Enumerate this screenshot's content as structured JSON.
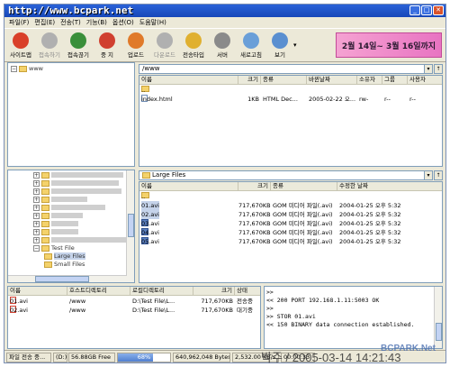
{
  "window": {
    "title": "http://www.bcpark.net"
  },
  "menu": [
    "파일(F)",
    "편집(E)",
    "전송(T)",
    "기능(B)",
    "옵션(O)",
    "도움말(H)"
  ],
  "toolbar": [
    {
      "label": "사이트맵",
      "icon": "sitemap-icon",
      "color": "#d9402a",
      "enabled": true
    },
    {
      "label": "접속하기",
      "icon": "connect-icon",
      "color": "#b0b0b0",
      "enabled": false
    },
    {
      "label": "접속끊기",
      "icon": "disconnect-icon",
      "color": "#3a8f3a",
      "enabled": true
    },
    {
      "label": "중 지",
      "icon": "stop-icon",
      "color": "#d04030",
      "enabled": true
    },
    {
      "label": "업로드",
      "icon": "upload-icon",
      "color": "#e07a2a",
      "enabled": true
    },
    {
      "label": "다운로드",
      "icon": "download-icon",
      "color": "#b0b0b0",
      "enabled": false
    },
    {
      "label": "전송타입",
      "icon": "transfer-type-icon",
      "color": "#e0b030",
      "enabled": true
    },
    {
      "label": "서버",
      "icon": "server-icon",
      "color": "#8a8a8a",
      "enabled": true
    },
    {
      "label": "새로고침",
      "icon": "refresh-icon",
      "color": "#6a9fd8",
      "enabled": true
    },
    {
      "label": "보기",
      "icon": "view-icon",
      "color": "#5a8fd0",
      "enabled": true
    }
  ],
  "banner": "2월 14일~ 3월 16일까지",
  "remote": {
    "root_folder": "www",
    "path": "/www",
    "columns": [
      "이름",
      "크기",
      "종류",
      "바뀐날짜",
      "소유자",
      "그룹",
      "사용자"
    ],
    "rows": [
      {
        "name": "..",
        "size": "",
        "type": "",
        "date": "",
        "owner": "",
        "group": "",
        "user": ""
      },
      {
        "name": "index.html",
        "size": "1KB",
        "type": "HTML Dec...",
        "date": "2005-02-22 오...",
        "owner": "rw-",
        "group": "r--",
        "user": "r--"
      }
    ]
  },
  "local": {
    "tree": [
      {
        "label": "Test File",
        "expanded": true
      },
      {
        "label": "Large Files",
        "expanded": false
      },
      {
        "label": "Small Files",
        "expanded": false
      }
    ],
    "path": "Large Files",
    "columns": [
      "이름",
      "크기",
      "종류",
      "수정한 날짜"
    ],
    "rows": [
      {
        "name": "..",
        "size": "",
        "type": "",
        "date": "",
        "selected": false
      },
      {
        "name": "01.avi",
        "size": "717,670KB",
        "type": "GOM 미디어 파일(.avi)",
        "date": "2004-01-25 오후 5:32",
        "selected": true
      },
      {
        "name": "02.avi",
        "size": "717,670KB",
        "type": "GOM 미디어 파일(.avi)",
        "date": "2004-01-25 오후 5:32",
        "selected": true
      },
      {
        "name": "03.avi",
        "size": "717,670KB",
        "type": "GOM 미디어 파일(.avi)",
        "date": "2004-01-25 오후 5:32",
        "selected": false
      },
      {
        "name": "04.avi",
        "size": "717,670KB",
        "type": "GOM 미디어 파일(.avi)",
        "date": "2004-01-25 오후 5:32",
        "selected": false
      },
      {
        "name": "05.avi",
        "size": "717,670KB",
        "type": "GOM 미디어 파일(.avi)",
        "date": "2004-01-25 오후 5:32",
        "selected": false
      }
    ]
  },
  "queue": {
    "columns": [
      "이름",
      "호스트디렉토리",
      "로컬디렉토리",
      "크기",
      "상태"
    ],
    "rows": [
      {
        "name": "01.avi",
        "host": "/www",
        "local": "D:\\Test File\\L...",
        "size": "717,670KB",
        "status": "전송중"
      },
      {
        "name": "02.avi",
        "host": "/www",
        "local": "D:\\Test File\\L...",
        "size": "717,670KB",
        "status": "대기중"
      }
    ]
  },
  "log": [
    ">>",
    "<< 200 PORT 192.168.1.11:5003 OK",
    ">>",
    ">> STOR 01.avi",
    "<< 150 BINARY data connection established.",
    ""
  ],
  "status": {
    "label": "파일 전송 중...",
    "drive": "(D:)",
    "free": "56.88GB Free",
    "progress_percent": 68,
    "progress_label": "68%",
    "bytes": "640,962,048 Bytes",
    "speed": "2,532.00 KB/s",
    "time": "00:00:33"
  },
  "watermark": "박주 / 2005-03-14 14:21:43",
  "logo": "BCPARK.Net",
  "colors": {
    "title": "#1747b8",
    "banner": "#e874c2",
    "selection": "#c5d3ea"
  }
}
